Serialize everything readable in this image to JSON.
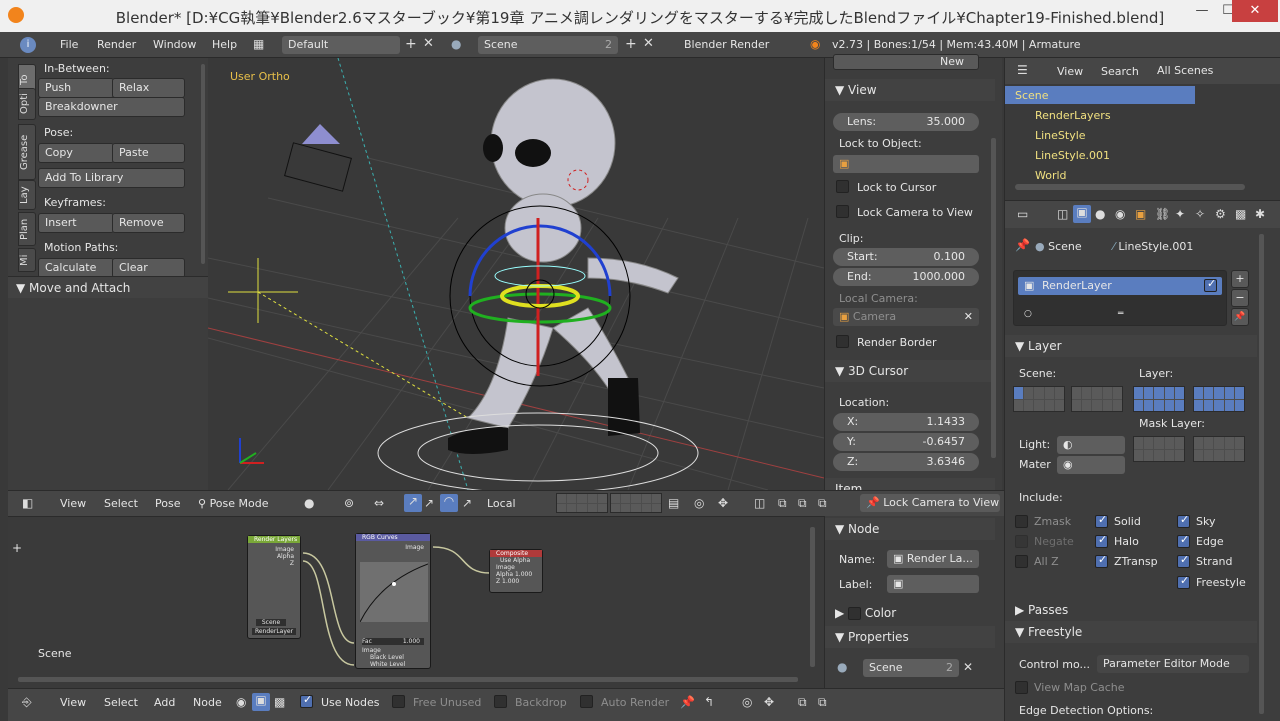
{
  "window": {
    "title": "Blender* [D:¥CG執筆¥Blender2.6マスターブック¥第19章 アニメ調レンダリングをマスターする¥完成したBlendファイル¥Chapter19-Finished.blend]",
    "min": "—",
    "max": "☐",
    "close": "✕"
  },
  "info": {
    "menus": [
      "File",
      "Render",
      "Window",
      "Help"
    ],
    "layout": "Default",
    "scene": "Scene",
    "scene_users": "2",
    "engine": "Blender Render",
    "stats": "v2.73 | Bones:1/54 | Mem:43.40M | Armature"
  },
  "toolshelf": {
    "tabs": [
      "To",
      "Opti",
      "Grease",
      "Lay",
      "Plan",
      "Mi"
    ],
    "inbetween_title": "In-Between:",
    "push": "Push",
    "relax": "Relax",
    "breakdowner": "Breakdowner",
    "pose_title": "Pose:",
    "copy": "Copy",
    "paste": "Paste",
    "add_library": "Add To Library",
    "keyframes_title": "Keyframes:",
    "insert": "Insert",
    "remove": "Remove",
    "motion_title": "Motion Paths:",
    "calculate": "Calculate",
    "clear": "Clear",
    "move_attach": "Move and Attach"
  },
  "viewport": {
    "label": "User Ortho",
    "header": {
      "view": "View",
      "select": "Select",
      "pose": "Pose",
      "mode": "Pose Mode",
      "orientation": "Local",
      "lock": "Lock Camera to View"
    }
  },
  "npanel": {
    "new": "New",
    "view_title": "View",
    "lens_label": "Lens:",
    "lens_value": "35.000",
    "lock_object": "Lock to Object:",
    "lock_cursor": "Lock to Cursor",
    "lock_camera": "Lock Camera to View",
    "clip": "Clip:",
    "start_label": "Start:",
    "start_value": "0.100",
    "end_label": "End:",
    "end_value": "1000.000",
    "local_camera": "Local Camera:",
    "camera": "Camera",
    "render_border": "Render Border",
    "cursor_title": "3D Cursor",
    "location": "Location:",
    "x_label": "X:",
    "x_value": "1.1433",
    "y_label": "Y:",
    "y_value": "-0.6457",
    "z_label": "Z:",
    "z_value": "3.6346",
    "item": "Item"
  },
  "outliner": {
    "view": "View",
    "search": "Search",
    "filter": "All Scenes",
    "items": [
      "Scene",
      "RenderLayers",
      "LineStyle",
      "LineStyle.001",
      "World"
    ]
  },
  "properties": {
    "breadcrumb_scene": "Scene",
    "breadcrumb_ls": "LineStyle.001",
    "renderlayer": "RenderLayer",
    "layer_title": "Layer",
    "scene_label": "Scene:",
    "layer_label": "Layer:",
    "mask_label": "Mask Layer:",
    "light": "Light:",
    "mater": "Mater",
    "include": "Include:",
    "zmask": "Zmask",
    "negate": "Negate",
    "allz": "All Z",
    "solid": "Solid",
    "halo": "Halo",
    "ztransp": "ZTransp",
    "sky": "Sky",
    "edge": "Edge",
    "strand": "Strand",
    "freestyle": "Freestyle",
    "passes": "Passes",
    "freestyle_title": "Freestyle",
    "control_label": "Control mo...",
    "control_value": "Parameter Editor Mode",
    "view_map": "View Map Cache",
    "edge_detect": "Edge Detection Options:"
  },
  "node_editor": {
    "scene_label": "Scene",
    "header": {
      "view": "View",
      "select": "Select",
      "add": "Add",
      "node": "Node",
      "use_nodes": "Use Nodes",
      "free_unused": "Free Unused",
      "backdrop": "Backdrop",
      "auto_render": "Auto Render"
    },
    "node_panel": {
      "title": "Node",
      "name_label": "Name:",
      "name_value": "Render La...",
      "label_label": "Label:",
      "color": "Color",
      "properties": "Properties",
      "scene": "Scene",
      "scene_users": "2"
    },
    "nodes": {
      "rl_title": "Render Layers",
      "rl_out1": "Image",
      "rl_out2": "Alpha",
      "rl_out3": "Z",
      "rl_scene": "Scene",
      "rl_layer": "RenderLayer",
      "curves_title": "RGB Curves",
      "curves_out": "Image",
      "curves_fac": "Fac",
      "curves_fac_val": "1.000",
      "curves_in": "Image",
      "curves_black": "Black Level",
      "curves_white": "White Level",
      "comp_title": "Composite",
      "comp_alpha": "Use Alpha",
      "comp_in": "Image",
      "comp_a": "Alpha",
      "comp_a_val": "1.000",
      "comp_z": "Z",
      "comp_z_val": "1.000"
    }
  },
  "colors": {
    "accent": "#5a7dbf",
    "node_green": "#7aa838",
    "node_red": "#b03a3a",
    "node_purple": "#5a5aa0"
  }
}
